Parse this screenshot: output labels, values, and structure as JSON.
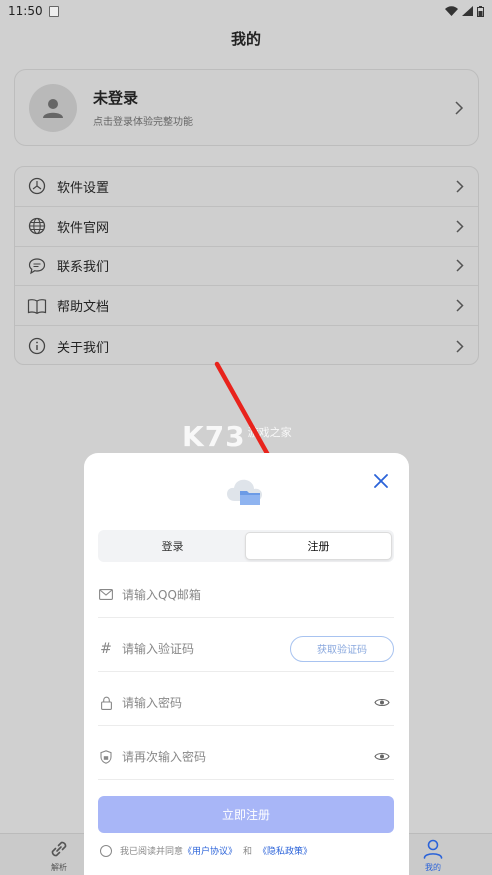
{
  "status_bar": {
    "time": "11:50"
  },
  "page": {
    "title": "我的"
  },
  "profile": {
    "name": "未登录",
    "subtitle": "点击登录体验完整功能"
  },
  "menu": {
    "items": [
      {
        "label": "软件设置",
        "icon": "settings-icon"
      },
      {
        "label": "软件官网",
        "icon": "globe-icon"
      },
      {
        "label": "联系我们",
        "icon": "chat-icon"
      },
      {
        "label": "帮助文档",
        "icon": "book-icon"
      },
      {
        "label": "关于我们",
        "icon": "info-icon"
      }
    ]
  },
  "bottom_nav": {
    "left_label": "解析",
    "right_label": "我的"
  },
  "watermark": {
    "brand": "K73",
    "sub": "游戏之家"
  },
  "modal": {
    "tabs": [
      {
        "label": "登录",
        "active": false
      },
      {
        "label": "注册",
        "active": true
      }
    ],
    "email_placeholder": "请输入QQ邮箱",
    "code_placeholder": "请输入验证码",
    "get_code_label": "获取验证码",
    "password_placeholder": "请输入密码",
    "confirm_password_placeholder": "请再次输入密码",
    "submit_label": "立即注册",
    "agree_text": "我已阅读并同意",
    "user_agreement": "《用户协议》",
    "and": "和",
    "privacy_policy": "《隐私政策》"
  },
  "colors": {
    "accent": "#2b63d9",
    "submit_bg": "#a8b6f7",
    "arrow": "#e8231c",
    "overlay_bg": "#d0d0d0"
  }
}
